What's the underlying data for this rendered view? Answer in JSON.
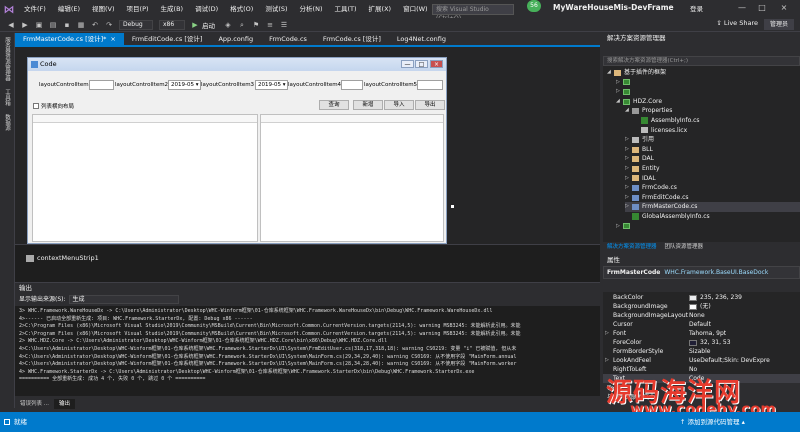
{
  "menu": [
    "文件(F)",
    "编辑(E)",
    "视图(V)",
    "项目(P)",
    "生成(B)",
    "调试(D)",
    "格式(O)",
    "测试(S)",
    "分析(N)",
    "工具(T)",
    "扩展(X)",
    "窗口(W)",
    "帮助(H)"
  ],
  "search_placeholder": "搜索 Visual Studio (Ctrl+Q)",
  "avatar_text": "56",
  "window_title": "MyWareHouseMis-DevFrame",
  "signin": "登录",
  "toolbar": {
    "config": "Debug",
    "platform": "x86",
    "start": "启动",
    "live_share": "Live Share",
    "admin": "管理员"
  },
  "left_strip": [
    "服务器资源管理器",
    "工具箱",
    "数据源"
  ],
  "doc_tabs": [
    {
      "label": "FrmMasterCode.cs [设计]*",
      "active": true,
      "close": "×"
    },
    {
      "label": "FrmEditCode.cs [设计]",
      "active": false
    },
    {
      "label": "App.config",
      "active": false
    },
    {
      "label": "FrmCode.cs",
      "active": false
    },
    {
      "label": "FrmCode.cs [设计]",
      "active": false
    },
    {
      "label": "Log4Net.config",
      "active": false
    }
  ],
  "form": {
    "title": "Code",
    "items": [
      {
        "label": "layoutControlItem1"
      },
      {
        "label": "layoutControlItem2",
        "value": "2019-05"
      },
      {
        "label": "layoutControlItem3",
        "value": "2019-05"
      },
      {
        "label": "layoutControlItem4"
      },
      {
        "label": "layoutControlItem5"
      }
    ],
    "checkbox_label": "列表横向布局",
    "buttons": [
      "查询",
      "新增",
      "导入",
      "导出"
    ],
    "minimize": "—",
    "maximize": "□",
    "close": "×"
  },
  "context_menu_strip": "contextMenuStrip1",
  "output": {
    "header": "输出",
    "source_label": "显示输出来源(S):",
    "source_value": "生成",
    "lines": [
      "3>  WHC.Framework.WareHouseDx -> C:\\Users\\Administrator\\Desktop\\WHC-Winform框架\\01-仓库系统框架\\WHC.Framework.WareHouseDx\\bin\\Debug\\WHC.Framework.WareHouseDx.dll",
      "4>------ 已启动全部重新生成: 项目: WHC.Framework.StarterDx, 配置: Debug x86 ------",
      "2>C:\\Program Files (x86)\\Microsoft Visual Studio\\2019\\Community\\MSBuild\\Current\\Bin\\Microsoft.Common.CurrentVersion.targets(2114,5): warning MSB3245: 未能解析此引用。未能",
      "2>C:\\Program Files (x86)\\Microsoft Visual Studio\\2019\\Community\\MSBuild\\Current\\Bin\\Microsoft.Common.CurrentVersion.targets(2114,5): warning MSB3245: 未能解析此引用。未能",
      "2>  WHC.HDZ.Core -> C:\\Users\\Administrator\\Desktop\\WHC-Winform框架\\01-仓库系统框架\\WHC.HDZ.Core\\bin\\x86\\Debug\\WHC.HDZ.Core.dll",
      "4>C:\\Users\\Administrator\\Desktop\\WHC-Winform框架\\01-仓库系统框架\\WHC.Framework.StarterDx\\UI\\System\\FrmEditUser.cs(318,17,318,18): warning CS0219: 变量 \"i\" 已被赋值, 但从未",
      "4>C:\\Users\\Administrator\\Desktop\\WHC-Winform框架\\01-仓库系统框架\\WHC.Framework.StarterDx\\UI\\System\\MainForm.cs(29,34,29,40): warning CS0169: 从不使用字段 \"MainForm.annual",
      "4>C:\\Users\\Administrator\\Desktop\\WHC-Winform框架\\01-仓库系统框架\\WHC.Framework.StarterDx\\UI\\System\\MainForm.cs(28,34,28,40): warning CS0169: 从不使用字段 \"MainForm.worker",
      "4>  WHC.Framework.StarterDx -> C:\\Users\\Administrator\\Desktop\\WHC-Winform框架\\01-仓库系统框架\\WHC.Framework.StarterDx\\bin\\Debug\\WHC.Framework.StarterDx.exe",
      "========== 全部重新生成: 成功 4 个, 失败 0 个, 跳过 0 个 =========="
    ],
    "tabs": [
      "错误列表 ...",
      "输出"
    ]
  },
  "solution": {
    "header": "解决方案资源管理器",
    "search_placeholder": "搜索解决方案资源管理器(Ctrl+;)",
    "nodes": [
      {
        "label": "基于插件的框架",
        "depth": 0,
        "icon": "folder",
        "arrow": "◢"
      },
      {
        "label": "",
        "depth": 1,
        "icon": "proj",
        "arrow": "▷"
      },
      {
        "label": "",
        "depth": 1,
        "icon": "proj",
        "arrow": "▷"
      },
      {
        "label": "HDZ.Core",
        "depth": 1,
        "icon": "proj",
        "arrow": "◢"
      },
      {
        "label": "Properties",
        "depth": 2,
        "icon": "wrench",
        "arrow": "◢"
      },
      {
        "label": "AssemblyInfo.cs",
        "depth": 3,
        "icon": "cs",
        "arrow": ""
      },
      {
        "label": "licenses.licx",
        "depth": 3,
        "icon": "file",
        "arrow": ""
      },
      {
        "label": "引用",
        "depth": 2,
        "icon": "file",
        "arrow": "▷"
      },
      {
        "label": "BLL",
        "depth": 2,
        "icon": "folder",
        "arrow": "▷"
      },
      {
        "label": "DAL",
        "depth": 2,
        "icon": "folder",
        "arrow": "▷"
      },
      {
        "label": "Entity",
        "depth": 2,
        "icon": "folder",
        "arrow": "▷"
      },
      {
        "label": "IDAL",
        "depth": 2,
        "icon": "folder",
        "arrow": "▷"
      },
      {
        "label": "FrmCode.cs",
        "depth": 2,
        "icon": "form",
        "arrow": "▷"
      },
      {
        "label": "FrmEditCode.cs",
        "depth": 2,
        "icon": "form",
        "arrow": "▷"
      },
      {
        "label": "FrmMasterCode.cs",
        "depth": 2,
        "icon": "form",
        "arrow": "▷",
        "selected": true
      },
      {
        "label": "GlobalAssemblyInfo.cs",
        "depth": 2,
        "icon": "cs",
        "arrow": ""
      },
      {
        "label": "",
        "depth": 1,
        "icon": "proj",
        "arrow": "▷"
      }
    ],
    "tabs": [
      "解决方案资源管理器",
      "团队资源管理器"
    ]
  },
  "properties": {
    "header": "属性",
    "object_name": "FrmMasterCode",
    "object_type": "WHC.Framework.BaseUI.BaseDock",
    "rows": [
      {
        "name": "BackColor",
        "value": "235, 236, 239",
        "swatch": "#ebecef"
      },
      {
        "name": "BackgroundImage",
        "value": "(无)",
        "swatch": "#ffffff"
      },
      {
        "name": "BackgroundImageLayout",
        "value": "None"
      },
      {
        "name": "Cursor",
        "value": "Default"
      },
      {
        "name": "Font",
        "value": "Tahoma, 9pt",
        "expander": "▷"
      },
      {
        "name": "ForeColor",
        "value": "32, 31, 53",
        "swatch": "#201f35"
      },
      {
        "name": "FormBorderStyle",
        "value": "Sizable"
      },
      {
        "name": "LookAndFeel",
        "value": "UseDefault;Skin: DevExpre",
        "expander": "▷"
      },
      {
        "name": "RightToLeft",
        "value": "No"
      },
      {
        "name": "Text",
        "value": "Code",
        "selected": true
      }
    ],
    "desc_title": "Text",
    "desc_text": "与控件关联的文本。"
  },
  "watermark": {
    "line1": "源码海洋网",
    "line2": "www.codehy.com"
  },
  "status": {
    "ready": "就绪",
    "add_source": "↑ 添加到源代码管理 ▴"
  },
  "colors": {
    "accent": "#007acc",
    "vs_purple": "#b180d7"
  }
}
